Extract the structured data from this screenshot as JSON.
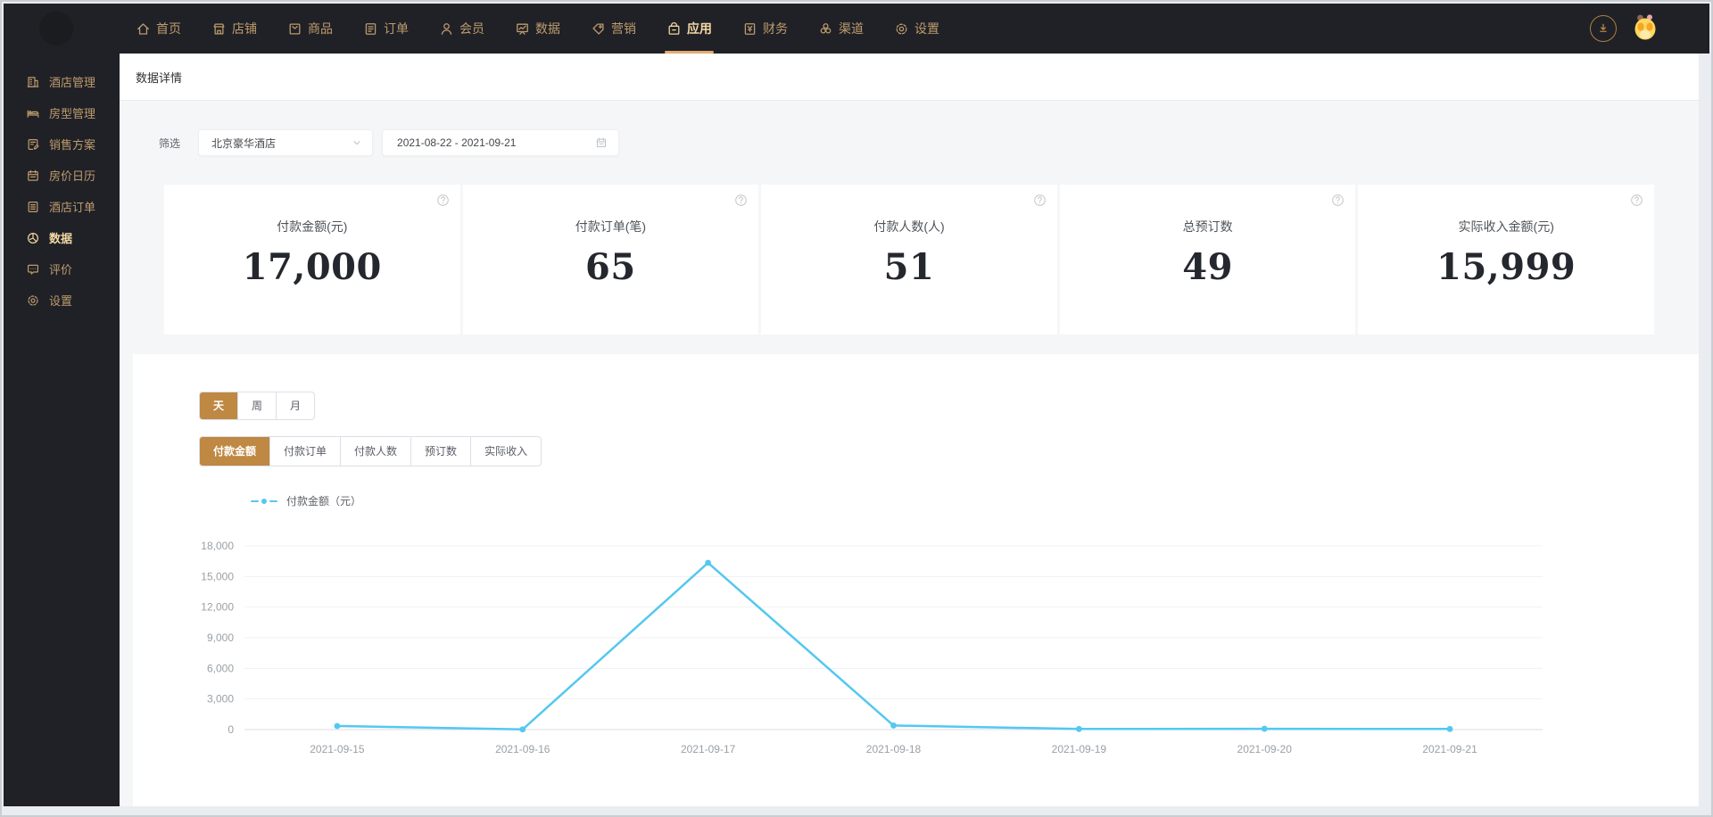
{
  "topnav": {
    "items": [
      {
        "label": "首页",
        "icon": "home",
        "active": false
      },
      {
        "label": "店铺",
        "icon": "shop",
        "active": false
      },
      {
        "label": "商品",
        "icon": "goods",
        "active": false
      },
      {
        "label": "订单",
        "icon": "order",
        "active": false
      },
      {
        "label": "会员",
        "icon": "member",
        "active": false
      },
      {
        "label": "数据",
        "icon": "data-board",
        "active": false
      },
      {
        "label": "营销",
        "icon": "marketing-tag",
        "active": false
      },
      {
        "label": "应用",
        "icon": "app-bag",
        "active": true
      },
      {
        "label": "财务",
        "icon": "finance",
        "active": false
      },
      {
        "label": "渠道",
        "icon": "channel",
        "active": false
      },
      {
        "label": "设置",
        "icon": "settings-gear",
        "active": false
      }
    ],
    "actions": [
      {
        "name": "download-button",
        "icon": "download"
      },
      {
        "name": "avatar",
        "icon": "avatar"
      }
    ]
  },
  "sidebar": {
    "items": [
      {
        "label": "酒店管理",
        "icon": "hotel-building",
        "active": false
      },
      {
        "label": "房型管理",
        "icon": "bed",
        "active": false
      },
      {
        "label": "销售方案",
        "icon": "sales-doc",
        "active": false
      },
      {
        "label": "房价日历",
        "icon": "calendar",
        "active": false
      },
      {
        "label": "酒店订单",
        "icon": "order-doc",
        "active": false
      },
      {
        "label": "数据",
        "icon": "data-pie",
        "active": true
      },
      {
        "label": "评价",
        "icon": "review-bubble",
        "active": false
      },
      {
        "label": "设置",
        "icon": "settings-gear",
        "active": false
      }
    ]
  },
  "page": {
    "title": "数据详情"
  },
  "filter": {
    "label": "筛选",
    "hotel_select": {
      "value": "北京豪华酒店",
      "icon": "chevron-down"
    },
    "date_range": {
      "value": "2021-08-22 - 2021-09-21",
      "icon": "calendar"
    }
  },
  "stats": {
    "cards": [
      {
        "label": "付款金额(元)",
        "value": "17,000",
        "help_icon": "question"
      },
      {
        "label": "付款订单(笔)",
        "value": "65",
        "help_icon": "question"
      },
      {
        "label": "付款人数(人)",
        "value": "51",
        "help_icon": "question"
      },
      {
        "label": "总预订数",
        "value": "49",
        "help_icon": "question"
      },
      {
        "label": "实际收入金额(元)",
        "value": "15,999",
        "help_icon": "question"
      }
    ]
  },
  "chart_section": {
    "period_tabs": [
      {
        "label": "天",
        "active": true
      },
      {
        "label": "周",
        "active": false
      },
      {
        "label": "月",
        "active": false
      }
    ],
    "metric_tabs": [
      {
        "label": "付款金额",
        "active": true
      },
      {
        "label": "付款订单",
        "active": false
      },
      {
        "label": "付款人数",
        "active": false
      },
      {
        "label": "预订数",
        "active": false
      },
      {
        "label": "实际收入",
        "active": false
      }
    ]
  },
  "chart_data": {
    "type": "line",
    "legend": [
      "付款金额（元）"
    ],
    "legend_position": "top-left",
    "x": [
      "2021-09-15",
      "2021-09-16",
      "2021-09-17",
      "2021-09-18",
      "2021-09-19",
      "2021-09-20",
      "2021-09-21"
    ],
    "series": [
      {
        "name": "付款金额（元）",
        "values": [
          350,
          20,
          16340,
          400,
          60,
          80,
          60
        ]
      }
    ],
    "ylim": [
      0,
      18000
    ],
    "yticks": [
      0,
      3000,
      6000,
      9000,
      12000,
      15000,
      18000
    ],
    "grid": true,
    "line_color": "#54c8f0"
  },
  "colors": {
    "nav_bg": "#1f2127",
    "nav_gold": "#bf9b6c",
    "nav_gold_active": "#f2d7a2",
    "accent_tab": "#bf8843",
    "line": "#54c8f0"
  }
}
